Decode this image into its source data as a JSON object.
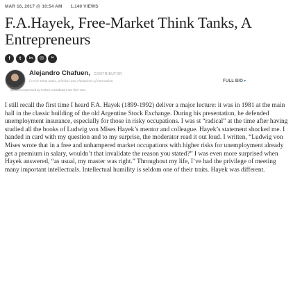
{
  "meta": {
    "date": "MAR 16, 2017 @ 10:54 AM",
    "views": "1,140 VIEWS"
  },
  "article": {
    "title": "F.A.Hayek, Free-Market Think Tanks, A Entrepreneurs",
    "body": "I still recall the first time I heard F.A. Hayek (1899-1992) deliver a major lecture: it was in 1981 at the main hall in the classic building of the old Argentine Stock Exchange. During his presentation, he defended unemployment insurance, especially for those in risky occupations. I was st “radical” at the time after having studied all the books of Ludwig von Mises Hayek’s mentor and colleague. Hayek’s statement shocked me. I handed in card with my question and to my surprise, the moderator read it out loud. I written, “Ludwig von Mises wrote that in a free and unhampered market occupations with higher risks for unemployment already get a premium in salary, wouldn’t that invalidate the reason you stated?” I was even more surprised when Hayek answered, “as usual, my master was right.” Throughout my life, I’ve had the privilege of meeting many important intellectuals. Intellectual humility is seldom one of their traits. Hayek was different."
  },
  "share": {
    "buttons": [
      {
        "icon": "facebook-icon",
        "glyph": "f"
      },
      {
        "icon": "twitter-icon",
        "glyph": "t"
      },
      {
        "icon": "linkedin-icon",
        "glyph": "in"
      },
      {
        "icon": "email-icon",
        "glyph": "✉"
      },
      {
        "icon": "comment-icon",
        "glyph": "❝"
      }
    ]
  },
  "author": {
    "name": "Alejandro Chafuen,",
    "role": "CONTRIBUTOR",
    "bio": "I cover think tanks, scholars and champions of innovation.",
    "full_bio_label": "FULL BIO",
    "disclaimer": "Opinions expressed by Forbes Contributors are their own."
  },
  "colors": {
    "text": "#2a2a2a",
    "muted": "#9a9a9a",
    "icon_bg": "#2a2a2a",
    "accent": "#4a90c2"
  }
}
